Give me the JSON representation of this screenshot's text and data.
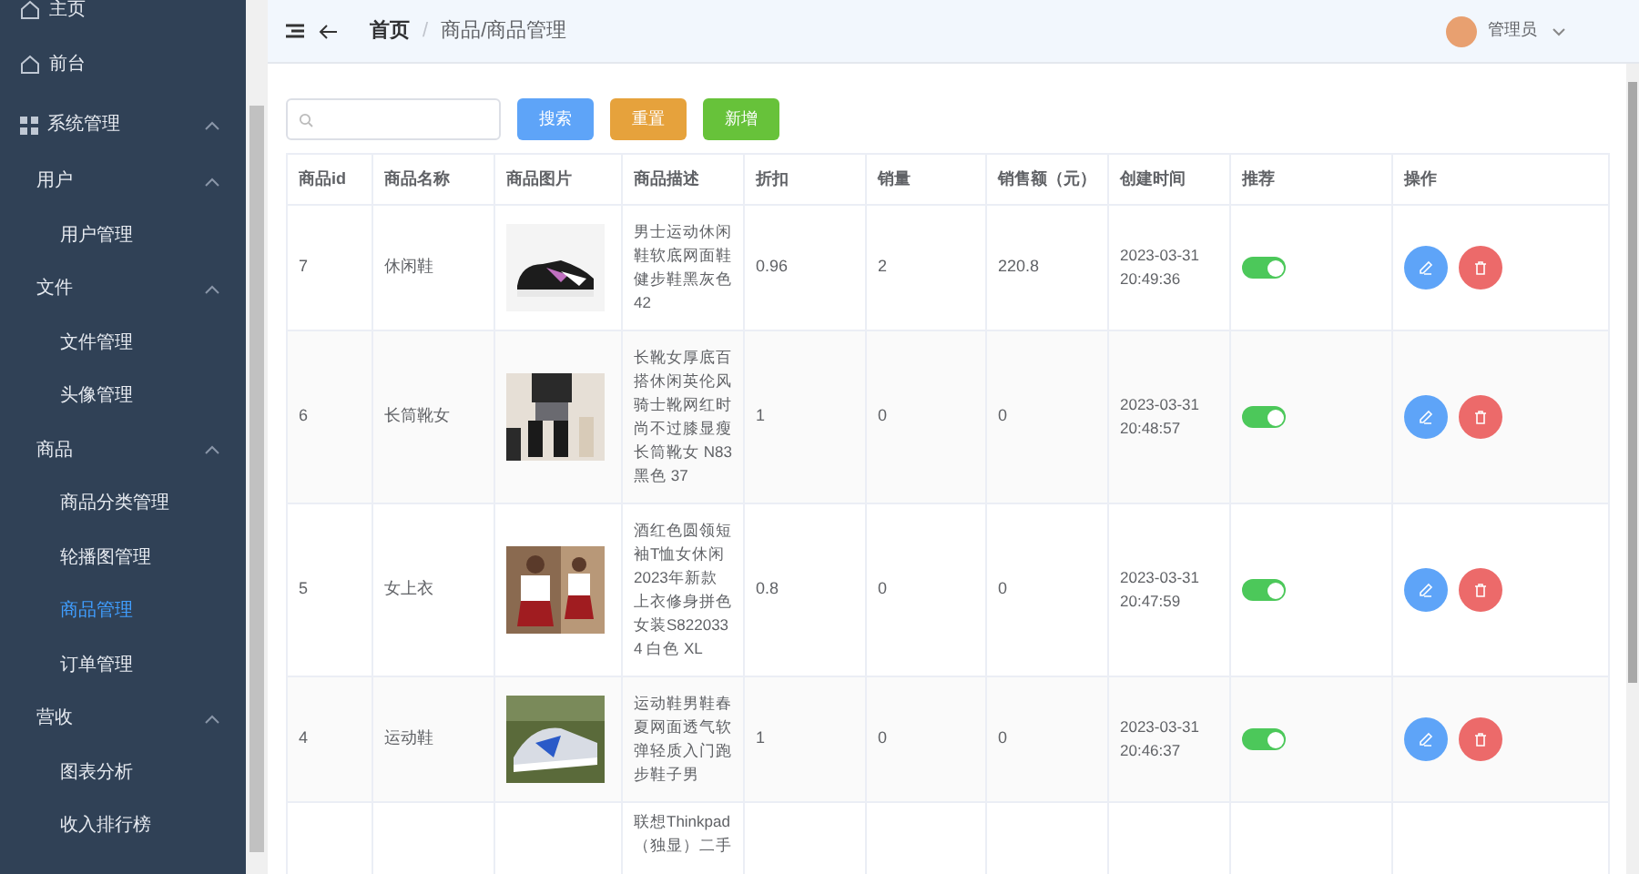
{
  "sidebar": {
    "items": [
      {
        "label": "主页",
        "kind": "home"
      },
      {
        "label": "前台",
        "kind": "home"
      },
      {
        "label": "系统管理",
        "kind": "grid",
        "expanded": true,
        "children": [
          {
            "label": "用户",
            "expanded": true,
            "children": [
              {
                "label": "用户管理",
                "selected": false
              }
            ]
          },
          {
            "label": "文件",
            "expanded": true,
            "children": [
              {
                "label": "文件管理",
                "selected": false
              },
              {
                "label": "头像管理",
                "selected": false
              }
            ]
          },
          {
            "label": "商品",
            "expanded": true,
            "children": [
              {
                "label": "商品分类管理",
                "selected": false
              },
              {
                "label": "轮播图管理",
                "selected": false
              },
              {
                "label": "商品管理",
                "selected": true
              },
              {
                "label": "订单管理",
                "selected": false
              }
            ]
          },
          {
            "label": "营收",
            "expanded": true,
            "children": [
              {
                "label": "图表分析",
                "selected": false
              },
              {
                "label": "收入排行榜",
                "selected": false
              }
            ]
          }
        ]
      }
    ]
  },
  "header": {
    "breadcrumb": [
      "首页",
      "商品/商品管理"
    ],
    "breadcrumb_separator": "/",
    "user": "管理员"
  },
  "toolbar": {
    "buttons": [
      {
        "label": "搜索",
        "kind": "primary"
      },
      {
        "label": "重置",
        "kind": "warning"
      },
      {
        "label": "新增",
        "kind": "success"
      }
    ]
  },
  "table": {
    "columns": [
      "商品id",
      "商品名称",
      "商品图片",
      "商品描述",
      "折扣",
      "销量",
      "销售额（元）",
      "创建时间",
      "推荐",
      "操作"
    ],
    "rows": [
      {
        "id": "7",
        "name": "休闲鞋",
        "description": "男士运动休闲鞋软底网面鞋健步鞋黑灰色42",
        "discount": "0.96",
        "sales": "2",
        "revenue": "220.8",
        "created": "2023-03-31 20:49:36",
        "recommended": true
      },
      {
        "id": "6",
        "name": "长筒靴女",
        "description": "长靴女厚底百搭休闲英伦风骑士靴网红时尚不过膝显瘦长筒靴女 N83 黑色 37",
        "discount": "1",
        "sales": "0",
        "revenue": "0",
        "created": "2023-03-31 20:48:57",
        "recommended": true
      },
      {
        "id": "5",
        "name": "女上衣",
        "description": "酒红色圆领短袖T恤女休闲2023年新款上衣修身拼色女装S8220334 白色 XL",
        "discount": "0.8",
        "sales": "0",
        "revenue": "0",
        "created": "2023-03-31 20:47:59",
        "recommended": true
      },
      {
        "id": "4",
        "name": "运动鞋",
        "description": "运动鞋男鞋春夏网面透气软弹轻质入门跑步鞋子男",
        "discount": "1",
        "sales": "0",
        "revenue": "0",
        "created": "2023-03-31 20:46:37",
        "recommended": true
      },
      {
        "description": "联想Thinkpad（独显）二手"
      }
    ]
  }
}
